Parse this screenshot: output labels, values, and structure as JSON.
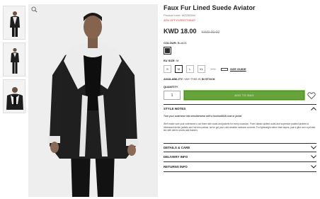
{
  "gallery": {
    "thumbnails": [
      {
        "name": "front view"
      },
      {
        "name": "full length view"
      },
      {
        "name": "detail view"
      }
    ]
  },
  "product": {
    "title": "Faux Fur Lined Suede Aviator",
    "code": "Product code: MZZ55944",
    "promo": "40% OFF EVERYTHING*",
    "price": "KWD 18.00",
    "was_price": "KWD 30.00",
    "colour_label": "COLOUR:",
    "colour_value": "BLACK",
    "colour_hex": "#2b2b2b",
    "size_label": "EU SIZE:",
    "size_value": "M",
    "sizes": [
      {
        "label": "S",
        "state": "available"
      },
      {
        "label": "M",
        "state": "selected"
      },
      {
        "label": "L",
        "state": "available"
      },
      {
        "label": "XL",
        "state": "available"
      },
      {
        "label": "XXL",
        "state": "sold-out"
      }
    ],
    "size_guide": "SIZE GUIDE",
    "availability_label": "AVAILABILITY:",
    "availability_text": "YAY! THIS IS",
    "availability_status": "IN STOCK",
    "quantity_label": "QUANTITY",
    "quantity_value": "1",
    "add_to_bag": "ADD TO BAG"
  },
  "accordions": {
    "style_notes": {
      "title": "STYLE NOTES",
      "lead": "Turn your outerwear into shoulderwear with a boohooMAN coat or jacket",
      "body": "We'll make sure your outerwear is out there with coats and jackets for every occasion. From classic quilted coats and supersize padded jackets to distressed denim jackets and hot trim parkas, we've got your cold weather seasons covered. For lightweight rather than layers, pair a gilet over a printed tee with denim shorts and trainers."
    },
    "items": [
      {
        "title": "DETAILS & CARE"
      },
      {
        "title": "DELIVERY INFO"
      },
      {
        "title": "RETURNS INFO"
      }
    ]
  },
  "colors": {
    "accent_green": "#66a33a",
    "promo_red": "#e0302a"
  }
}
